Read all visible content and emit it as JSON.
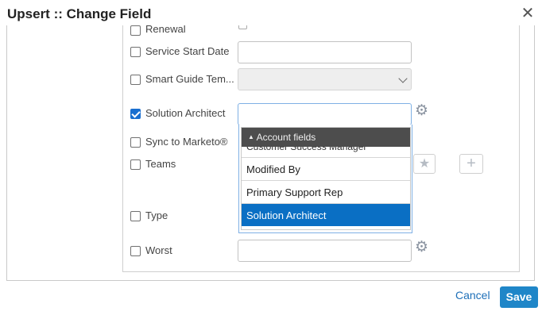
{
  "dialog": {
    "title": "Upsert :: Change Field",
    "close_icon": "✕"
  },
  "fields": [
    {
      "label": "Renewal",
      "checked": false
    },
    {
      "label": "Service Start Date",
      "checked": false
    },
    {
      "label": "Smart Guide Tem...",
      "checked": false
    },
    {
      "label": "Solution Architect",
      "checked": true
    },
    {
      "label": "Sync to Marketo®",
      "checked": false
    },
    {
      "label": "Teams",
      "checked": false
    },
    {
      "label": "Type",
      "checked": false
    },
    {
      "label": "Worst",
      "checked": false
    }
  ],
  "dropdown": {
    "group_header": "Account fields",
    "partial_item": "Customer Success Manager",
    "items": [
      "Modified By",
      "Primary Support Rep",
      "Solution Architect"
    ],
    "selected": "Solution Architect"
  },
  "footer": {
    "cancel_label": "Cancel",
    "save_label": "Save"
  },
  "icons": {
    "gear": "gear-icon",
    "star": "star-icon",
    "plus": "plus-icon",
    "caret": "caret-up-icon"
  },
  "colors": {
    "accent": "#1f86c8",
    "selected_item": "#0a6fc4",
    "dropdown_header": "#4d4d4d"
  }
}
